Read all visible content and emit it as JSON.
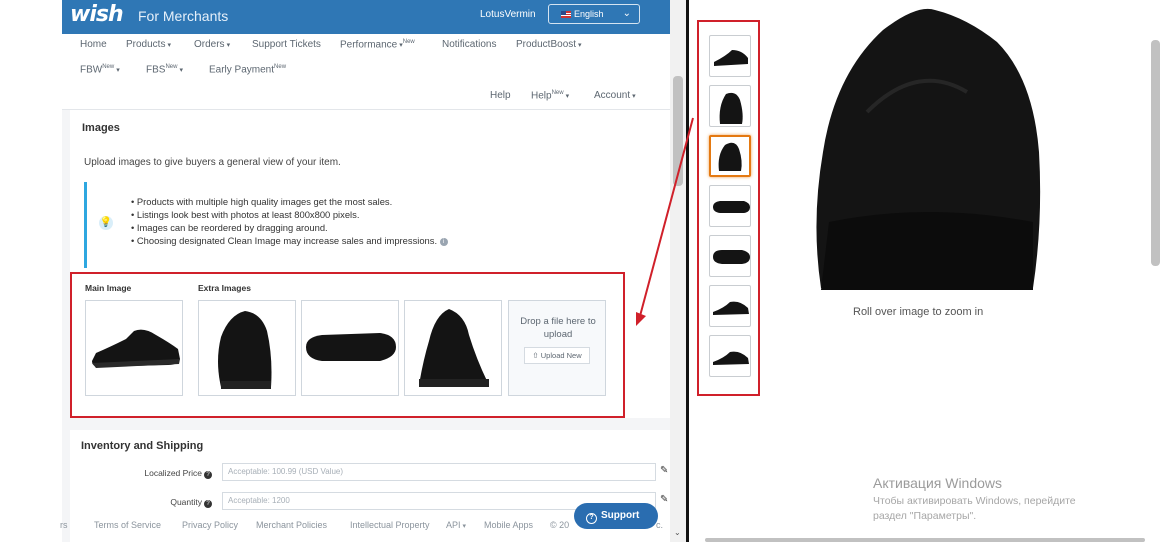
{
  "header": {
    "logo": "wish",
    "subtitle": "For Merchants",
    "username": "LotusVermin",
    "language": "English"
  },
  "nav": {
    "row1": [
      {
        "label": "Home",
        "caret": false,
        "sup": ""
      },
      {
        "label": "Products",
        "caret": true,
        "sup": ""
      },
      {
        "label": "Orders",
        "caret": true,
        "sup": ""
      },
      {
        "label": "Support Tickets",
        "caret": false,
        "sup": ""
      },
      {
        "label": "Performance",
        "caret": true,
        "sup": "New"
      },
      {
        "label": "Notifications",
        "caret": false,
        "sup": ""
      },
      {
        "label": "ProductBoost",
        "caret": true,
        "sup": ""
      }
    ],
    "row2": [
      {
        "label": "FBW",
        "caret": true,
        "sup": "New"
      },
      {
        "label": "FBS",
        "caret": true,
        "sup": "New"
      },
      {
        "label": "Early Payment",
        "caret": false,
        "sup": "New"
      }
    ],
    "row3": [
      {
        "label": "Help",
        "caret": false,
        "sup": ""
      },
      {
        "label": "Help",
        "caret": true,
        "sup": "New"
      },
      {
        "label": "Account",
        "caret": true,
        "sup": ""
      }
    ]
  },
  "images_section": {
    "title": "Images",
    "description": "Upload images to give buyers a general view of your item.",
    "tips": [
      "Products with multiple high quality images get the most sales.",
      "Listings look best with photos at least 800x800 pixels.",
      "Images can be reordered by dragging around.",
      "Choosing designated Clean Image may increase sales and impressions."
    ],
    "main_image_label": "Main Image",
    "extra_images_label": "Extra Images",
    "drop_text": "Drop a file here to upload",
    "upload_button": "Upload New"
  },
  "inventory_section": {
    "title": "Inventory and Shipping",
    "fields": [
      {
        "label": "Localized Price",
        "placeholder": "Acceptable: 100.99 (USD Value)"
      },
      {
        "label": "Quantity",
        "placeholder": "Acceptable: 1200"
      }
    ]
  },
  "footer": {
    "links": [
      "rs",
      "Terms of Service",
      "Privacy Policy",
      "Merchant Policies",
      "Intellectual Property",
      "API",
      "Mobile Apps",
      "© 20",
      "c."
    ],
    "support_label": "Support"
  },
  "product_viewer": {
    "zoom_caption": "Roll over image to zoom in",
    "thumbnail_count": 7,
    "selected_thumbnail": 3
  },
  "windows_watermark": {
    "title": "Активация Windows",
    "line1": "Чтобы активировать Windows, перейдите",
    "line2": "раздел \"Параметры\"."
  },
  "colors": {
    "wish_blue": "#2f77b5",
    "annotation_red": "#d0202a",
    "support_blue": "#2a6db0",
    "selected_orange": "#e47911"
  }
}
